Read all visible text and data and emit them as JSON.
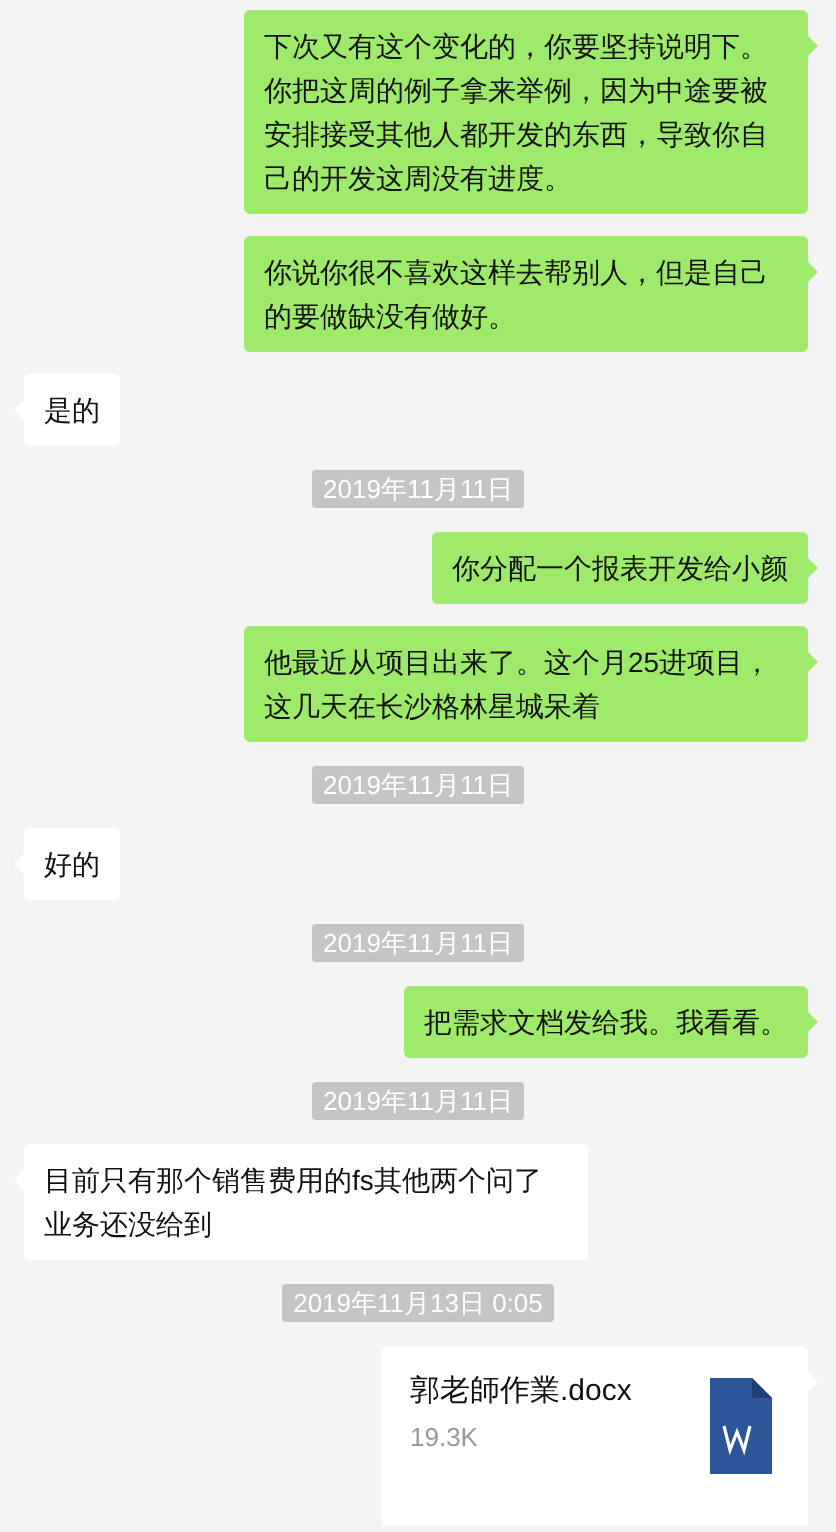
{
  "messages": [
    {
      "kind": "outgoing",
      "text": "下次又有这个变化的，你要坚持说明下。你把这周的例子拿来举例，因为中途要被安排接受其他人都开发的东西，导致你自己的开发这周没有进度。"
    },
    {
      "kind": "outgoing",
      "text": "你说你很不喜欢这样去帮别人，但是自己的要做缺没有做好。"
    },
    {
      "kind": "incoming",
      "text": "是的"
    },
    {
      "kind": "timestamp",
      "text": "2019年11月11日"
    },
    {
      "kind": "outgoing",
      "text": "你分配一个报表开发给小颜"
    },
    {
      "kind": "outgoing",
      "text": "他最近从项目出来了。这个月25进项目，这几天在长沙格林星城呆着"
    },
    {
      "kind": "timestamp",
      "text": "2019年11月11日"
    },
    {
      "kind": "incoming",
      "text": "好的"
    },
    {
      "kind": "timestamp",
      "text": "2019年11月11日"
    },
    {
      "kind": "outgoing",
      "text": "把需求文档发给我。我看看。"
    },
    {
      "kind": "timestamp",
      "text": "2019年11月11日"
    },
    {
      "kind": "incoming",
      "text": "目前只有那个销售费用的fs其他两个问了业务还没给到"
    },
    {
      "kind": "timestamp",
      "text": "2019年11月13日 0:05"
    },
    {
      "kind": "outgoing_file",
      "name": "郭老師作業.docx",
      "size": "19.3K"
    }
  ]
}
